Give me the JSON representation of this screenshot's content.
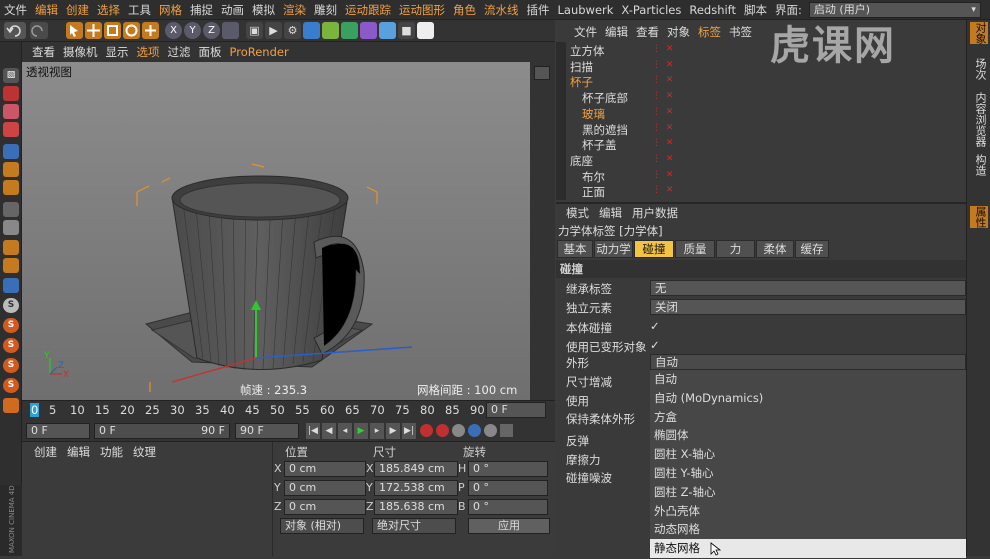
{
  "menubar": {
    "items": [
      "文件",
      "编辑",
      "创建",
      "选择",
      "工具",
      "网格",
      "捕捉",
      "动画",
      "模拟",
      "渲染",
      "雕刻",
      "运动跟踪",
      "运动图形",
      "角色",
      "流水线",
      "插件",
      "Laubwerk",
      "X-Particles",
      "Redshift",
      "脚本",
      "界面:"
    ],
    "layout_value": "启动 (用户)"
  },
  "viewport": {
    "menu": [
      "查看",
      "摄像机",
      "显示",
      "选项",
      "过滤",
      "面板",
      "ProRender"
    ],
    "label": "透视视图",
    "fps": "帧速 : 235.3",
    "grid": "网格间距 : 100 cm"
  },
  "timeline": {
    "frames": [
      "0",
      "5",
      "10",
      "15",
      "20",
      "25",
      "30",
      "35",
      "40",
      "45",
      "50",
      "55",
      "60",
      "65",
      "70",
      "75",
      "80",
      "85",
      "90"
    ],
    "end_frame": "0 F",
    "start": "0 F",
    "range_start": "0 F",
    "range_end": "90 F",
    "max": "90 F"
  },
  "materials": {
    "menu": [
      "创建",
      "编辑",
      "功能",
      "纹理"
    ]
  },
  "coords": {
    "headers": [
      "位置",
      "尺寸",
      "旋转"
    ],
    "rows": [
      {
        "axis": "X",
        "pos": "0 cm",
        "size_axis": "X",
        "size": "185.849 cm",
        "rot_axis": "H",
        "rot": "0 °"
      },
      {
        "axis": "Y",
        "pos": "0 cm",
        "size_axis": "Y",
        "size": "172.538 cm",
        "rot_axis": "P",
        "rot": "0 °"
      },
      {
        "axis": "Z",
        "pos": "0 cm",
        "size_axis": "Z",
        "size": "185.638 cm",
        "rot_axis": "B",
        "rot": "0 °"
      }
    ],
    "mode": "对象 (相对)",
    "size_mode": "绝对尺寸",
    "apply": "应用"
  },
  "objects": {
    "menu": [
      "文件",
      "编辑",
      "查看",
      "对象",
      "标签",
      "书签"
    ],
    "rows": [
      {
        "name": "立方体",
        "indent": 0,
        "color": "#ddd"
      },
      {
        "name": "扫描",
        "indent": 0,
        "color": "#ddd"
      },
      {
        "name": "杯子",
        "indent": 0,
        "color": "#f2a040"
      },
      {
        "name": "杯子底部",
        "indent": 1,
        "color": "#ddd"
      },
      {
        "name": "玻璃",
        "indent": 1,
        "color": "#f2a040"
      },
      {
        "name": "黑的遮挡",
        "indent": 1,
        "color": "#ddd"
      },
      {
        "name": "杯子盖",
        "indent": 1,
        "color": "#ddd"
      },
      {
        "name": "底座",
        "indent": 0,
        "color": "#ddd"
      },
      {
        "name": "布尔",
        "indent": 1,
        "color": "#ddd"
      },
      {
        "name": "正面",
        "indent": 1,
        "color": "#ddd"
      }
    ]
  },
  "attributes": {
    "menu": [
      "模式",
      "编辑",
      "用户数据"
    ],
    "tag_title": "力学体标签 [力学体]",
    "tabs": [
      "基本",
      "动力学",
      "碰撞",
      "质量",
      "力",
      "柔体",
      "缓存"
    ],
    "active_tab": "碰撞",
    "section": "碰撞",
    "props": [
      {
        "label": "继承标签",
        "value": "无"
      },
      {
        "label": "独立元素",
        "value": "关闭"
      }
    ],
    "checks": [
      {
        "label": "本体碰撞",
        "value": "✓"
      },
      {
        "label": "使用已变形对象",
        "value": "✓"
      }
    ],
    "shape_label": "外形",
    "shape_value": "自动",
    "other_labels": [
      "尺寸增减",
      "使用",
      "保持柔体外形",
      "反弹",
      "摩擦力",
      "碰撞噪波"
    ],
    "dropdown": [
      "自动",
      "自动 (MoDynamics)",
      "方盒",
      "椭圆体",
      "圆柱 X-轴心",
      "圆柱 Y-轴心",
      "圆柱 Z-轴心",
      "外凸壳体",
      "动态网格",
      "静态网格"
    ],
    "dropdown_selected": "静态网格"
  },
  "right_tabs": [
    "对象",
    "场次",
    "内容浏览器",
    "构造",
    "属性"
  ],
  "watermark": "虎课网"
}
